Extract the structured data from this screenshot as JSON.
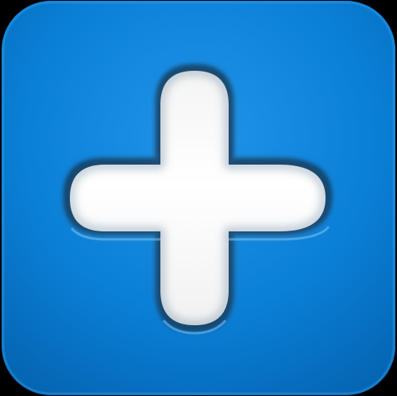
{
  "icon": {
    "name": "plus-icon",
    "colors": {
      "tile_light": "#1f95ea",
      "tile": "#0a7fd6",
      "tile_dark": "#0566b4",
      "plus_fill": "#ffffff",
      "plus_shadow": "#02284d",
      "background": "#000000"
    }
  }
}
